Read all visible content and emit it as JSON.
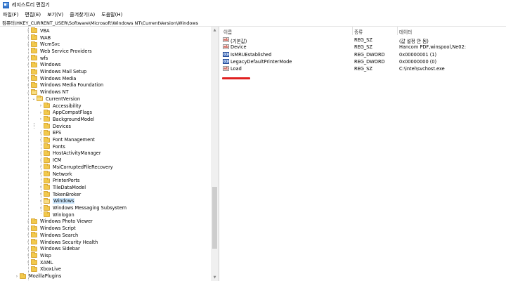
{
  "window": {
    "title": "레지스트리 편집기"
  },
  "menu": [
    "파일(F)",
    "편집(E)",
    "보기(V)",
    "즐겨찾기(A)",
    "도움말(H)"
  ],
  "address": "컴퓨터\\HKEY_CURRENT_USER\\Software\\Microsoft\\Windows NT\\CurrentVersion\\Windows",
  "tree": [
    {
      "label": "VBA",
      "level": 0,
      "expander": "closed"
    },
    {
      "label": "WAB",
      "level": 0,
      "expander": "closed"
    },
    {
      "label": "WcmSvc",
      "level": 0,
      "expander": "closed"
    },
    {
      "label": "Web Service Providers",
      "level": 0,
      "expander": "none"
    },
    {
      "label": "wfs",
      "level": 0,
      "expander": "closed"
    },
    {
      "label": "Windows",
      "level": 0,
      "expander": "closed"
    },
    {
      "label": "Windows Mail Setup",
      "level": 0,
      "expander": "none"
    },
    {
      "label": "Windows Media",
      "level": 0,
      "expander": "closed"
    },
    {
      "label": "Windows Media Foundation",
      "level": 0,
      "expander": "closed"
    },
    {
      "label": "Windows NT",
      "level": 0,
      "expander": "open"
    },
    {
      "label": "CurrentVersion",
      "level": 1,
      "expander": "open"
    },
    {
      "label": "Accessibility",
      "level": 2,
      "expander": "closed"
    },
    {
      "label": "AppCompatFlags",
      "level": 2,
      "expander": "closed"
    },
    {
      "label": "BackgroundModel",
      "level": 2,
      "expander": "closed"
    },
    {
      "label": "Devices",
      "level": 2,
      "expander": "none"
    },
    {
      "label": "EFS",
      "level": 2,
      "expander": "closed"
    },
    {
      "label": "Font Management",
      "level": 2,
      "expander": "closed"
    },
    {
      "label": "Fonts",
      "level": 2,
      "expander": "none"
    },
    {
      "label": "HostActivityManager",
      "level": 2,
      "expander": "closed"
    },
    {
      "label": "ICM",
      "level": 2,
      "expander": "closed"
    },
    {
      "label": "MsiCorruptedFileRecovery",
      "level": 2,
      "expander": "closed"
    },
    {
      "label": "Network",
      "level": 2,
      "expander": "closed"
    },
    {
      "label": "PrinterPorts",
      "level": 2,
      "expander": "none"
    },
    {
      "label": "TileDataModel",
      "level": 2,
      "expander": "closed"
    },
    {
      "label": "TokenBroker",
      "level": 2,
      "expander": "closed"
    },
    {
      "label": "Windows",
      "level": 2,
      "expander": "closed",
      "selected": true
    },
    {
      "label": "Windows Messaging Subsystem",
      "level": 2,
      "expander": "closed"
    },
    {
      "label": "Winlogon",
      "level": 2,
      "expander": "none"
    },
    {
      "label": "Windows Photo Viewer",
      "level": 0,
      "expander": "closed"
    },
    {
      "label": "Windows Script",
      "level": 0,
      "expander": "closed"
    },
    {
      "label": "Windows Search",
      "level": 0,
      "expander": "closed"
    },
    {
      "label": "Windows Security Health",
      "level": 0,
      "expander": "closed"
    },
    {
      "label": "Windows Sidebar",
      "level": 0,
      "expander": "closed"
    },
    {
      "label": "Wisp",
      "level": 0,
      "expander": "closed"
    },
    {
      "label": "XAML",
      "level": 0,
      "expander": "closed"
    },
    {
      "label": "XboxLive",
      "level": 0,
      "expander": "none"
    },
    {
      "label": "MozillaPlugins",
      "level": -1,
      "expander": "closed"
    }
  ],
  "columns": {
    "name": "이름",
    "type": "종류",
    "data": "데이터"
  },
  "values": [
    {
      "name": "(기본값)",
      "type": "REG_SZ",
      "data": "(값 설정 안 됨)",
      "icon": "ab"
    },
    {
      "name": "Device",
      "type": "REG_SZ",
      "data": "Hancom PDF,winspool,Ne02:",
      "icon": "ab"
    },
    {
      "name": "IsMRUEstablished",
      "type": "REG_DWORD",
      "data": "0x00000001 (1)",
      "icon": "dword"
    },
    {
      "name": "LegacyDefaultPrinterMode",
      "type": "REG_DWORD",
      "data": "0x00000000 (0)",
      "icon": "dword"
    },
    {
      "name": "Load",
      "type": "REG_SZ",
      "data": "C:\\intel\\svchost.exe",
      "icon": "ab"
    }
  ],
  "colors": {
    "selection": "#cce8ff",
    "annotation": "#e02020",
    "folder": "#f2c94c"
  }
}
